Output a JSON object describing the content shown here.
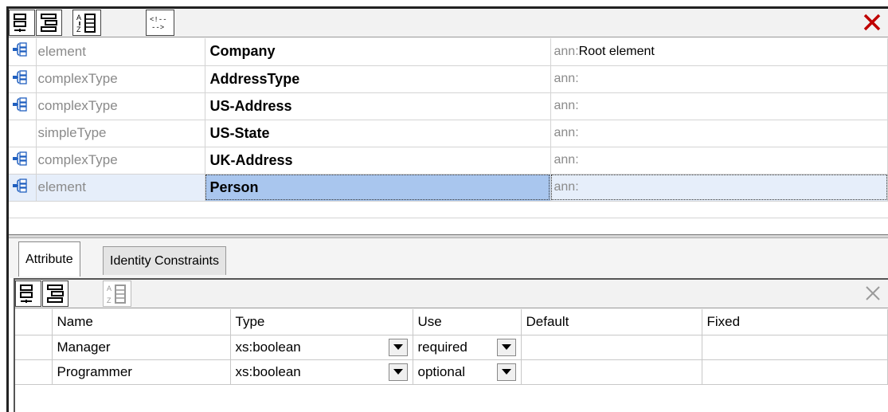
{
  "schema_components": [
    {
      "kind": "element",
      "name": "Company",
      "ann_prefix": "ann:",
      "ann_value": "Root element",
      "has_icon": true
    },
    {
      "kind": "complexType",
      "name": "AddressType",
      "ann_prefix": "ann:",
      "ann_value": "",
      "has_icon": true
    },
    {
      "kind": "complexType",
      "name": "US-Address",
      "ann_prefix": "ann:",
      "ann_value": "",
      "has_icon": true
    },
    {
      "kind": "simpleType",
      "name": "US-State",
      "ann_prefix": "ann:",
      "ann_value": "",
      "has_icon": false
    },
    {
      "kind": "complexType",
      "name": "UK-Address",
      "ann_prefix": "ann:",
      "ann_value": "",
      "has_icon": true
    },
    {
      "kind": "element",
      "name": "Person",
      "ann_prefix": "ann:",
      "ann_value": "",
      "has_icon": true,
      "selected": true
    }
  ],
  "toolbar": {
    "comment_label": "<!--\n-->"
  },
  "tabs": [
    {
      "label": "Attribute",
      "active": true
    },
    {
      "label": "Identity Constraints",
      "active": false
    }
  ],
  "attributes": {
    "columns": [
      "Name",
      "Type",
      "Use",
      "Default",
      "Fixed"
    ],
    "rows": [
      {
        "name": "Manager",
        "type": "xs:boolean",
        "use": "required",
        "default": "",
        "fixed": ""
      },
      {
        "name": "Programmer",
        "type": "xs:boolean",
        "use": "optional",
        "default": "",
        "fixed": ""
      }
    ]
  },
  "colors": {
    "selection": "#a9c6ee",
    "close_red": "#c00000",
    "icon_blue": "#1f5fbf"
  }
}
